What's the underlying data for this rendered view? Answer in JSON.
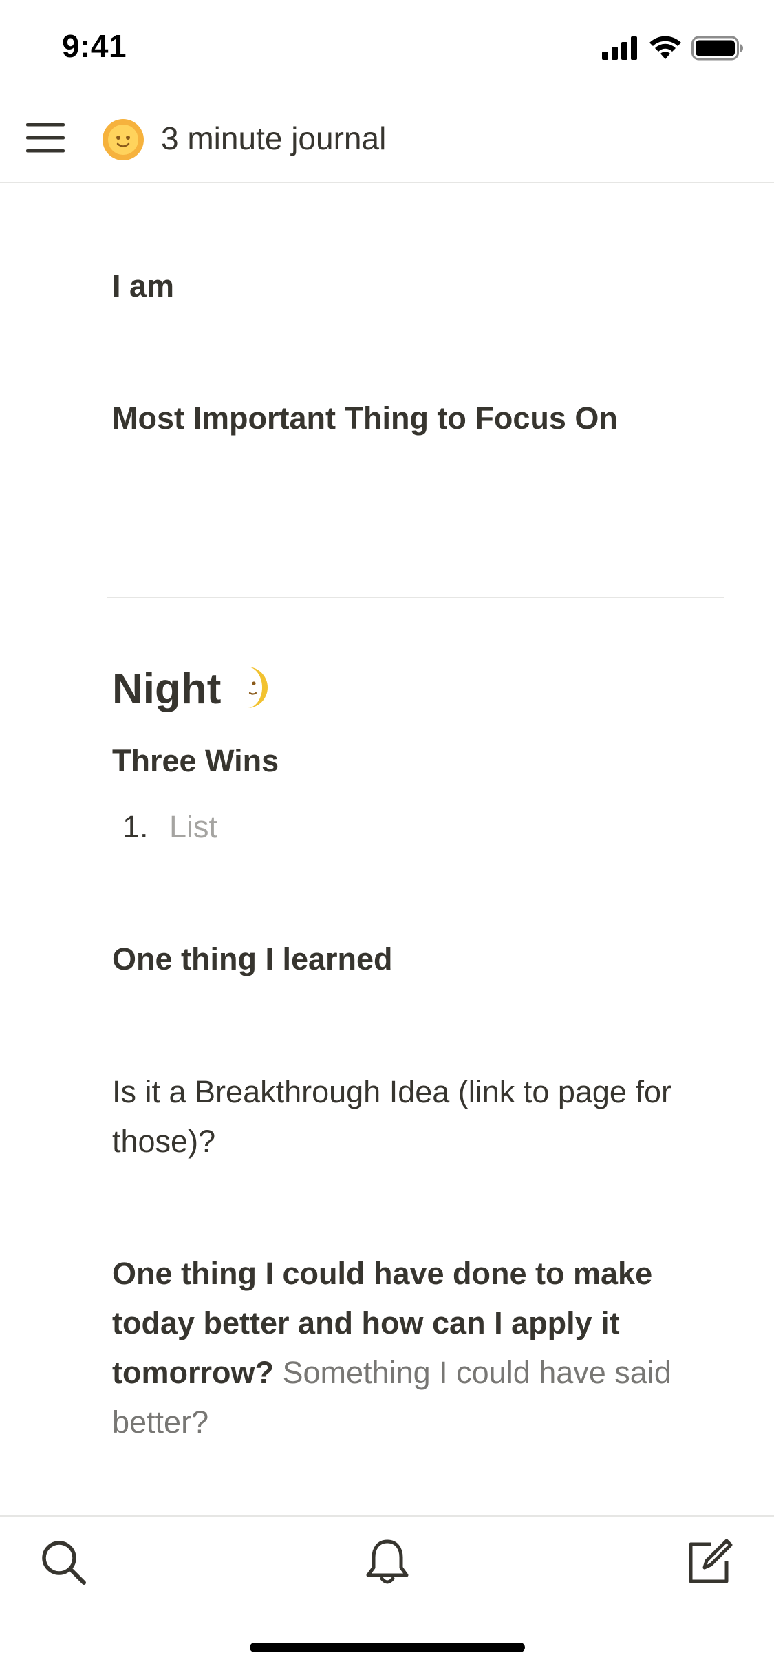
{
  "status_bar": {
    "time": "9:41",
    "icons": [
      "signal-icon",
      "wifi-icon",
      "battery-icon"
    ]
  },
  "header": {
    "menu_icon": "hamburger-menu-icon",
    "page_emoji": "sun-with-face-icon",
    "title": "3 minute journal"
  },
  "content": {
    "i_am_label": "I am",
    "focus_label": "Most Important Thing to Focus On",
    "night_heading": "Night",
    "night_emoji": "moon-face-icon",
    "three_wins_label": "Three Wins",
    "wins_list": [
      {
        "number": "1.",
        "placeholder": "List"
      }
    ],
    "learned_label": "One thing I learned",
    "breakthrough_text_line1": "Is it a Breakthrough Idea (link to page for",
    "breakthrough_text_line2": "those)?",
    "improve_bold_line1": "One thing I could have done to make",
    "improve_bold_line2": "today better and how can I apply it",
    "improve_bold_line3": "tomorrow?",
    "improve_muted_line3": "Something I could have said",
    "improve_muted_line4": "better?"
  },
  "bottom_bar": {
    "tabs": [
      "search-icon",
      "bell-icon",
      "compose-icon"
    ]
  },
  "colors": {
    "text": "#37352f",
    "muted": "#787774",
    "placeholder": "#a5a4a1",
    "divider": "#e6e6e4",
    "background": "#ffffff"
  }
}
